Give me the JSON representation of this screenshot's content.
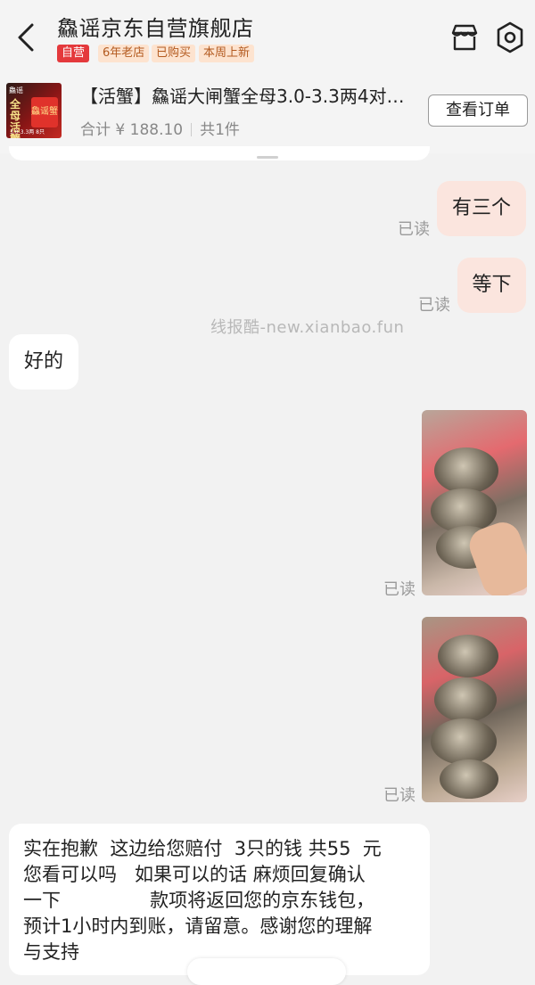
{
  "header": {
    "store_name": "鱻谣京东自营旗舰店",
    "tags": [
      "自营",
      "6年老店",
      "已购买",
      "本周上新"
    ],
    "icons": [
      "back-icon",
      "shop-icon",
      "settings-icon"
    ]
  },
  "order": {
    "thumbnail": {
      "brand": "鱻谣",
      "slogan": "全母活蟹",
      "box_text": "鱻谣蟹",
      "spec": "3.0-3.3两 8只"
    },
    "product_name": "【活蟹】鱻谣大闸蟹全母3.0-3.3两4对…",
    "total": "合计 ¥ 188.10",
    "count": "共1件",
    "view_order_label": "查看订单"
  },
  "watermark": "线报酷-new.xianbao.fun",
  "messages": [
    {
      "side": "out",
      "text": "有三个",
      "status": "已读"
    },
    {
      "side": "out",
      "text": "等下",
      "status": "已读"
    },
    {
      "side": "in",
      "text": "好的"
    },
    {
      "side": "out",
      "type": "image",
      "status": "已读"
    },
    {
      "side": "out",
      "type": "image",
      "status": "已读"
    },
    {
      "side": "in",
      "text": "实在抱歉  这边给您赔付  3只的钱 共55  元\n您看可以吗   如果可以的话 麻烦回复确认\n一下               款项将返回您的京东钱包，\n预计1小时内到账，请留意。感谢您的理解\n与支持"
    }
  ],
  "colors": {
    "self_tag": "#e4393c",
    "tag_bg": "#fde3cf",
    "outgoing_bubble": "#fbe5de",
    "incoming_bubble": "#ffffff",
    "background": "#f2f2f2"
  }
}
